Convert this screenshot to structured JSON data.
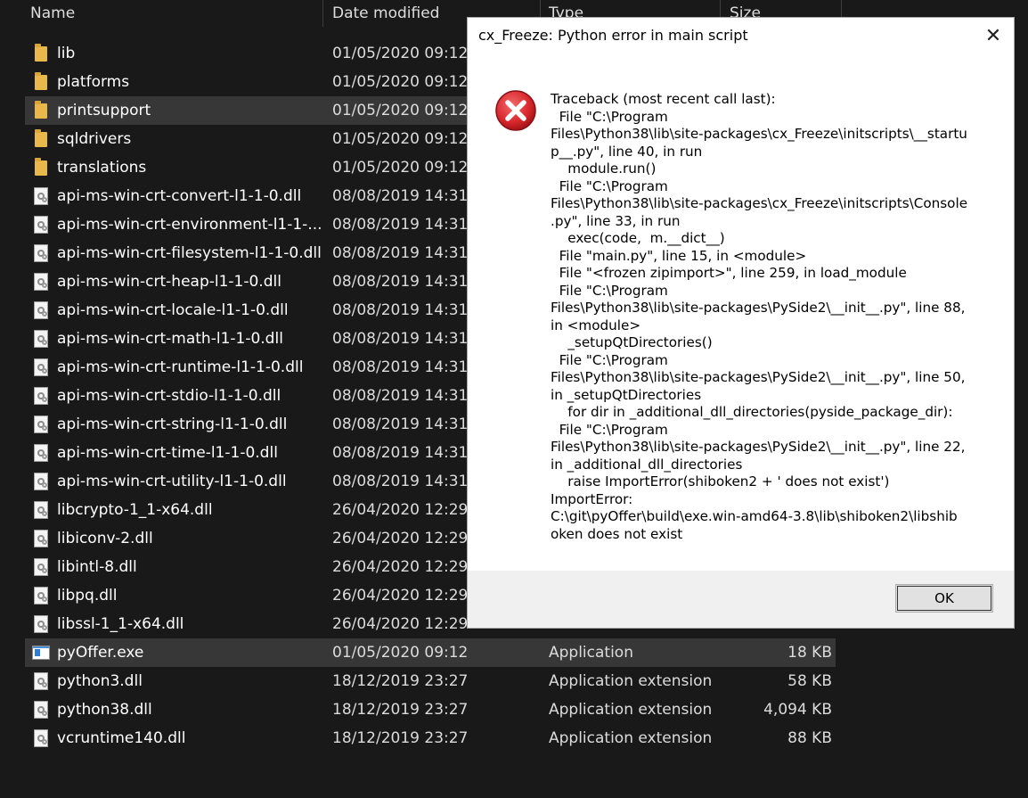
{
  "explorer": {
    "columns": {
      "name": "Name",
      "date": "Date modified",
      "type": "Type",
      "size": "Size"
    },
    "rows": [
      {
        "name": "lib",
        "date": "01/05/2020 09:12",
        "type": "",
        "size": "",
        "icon": "folder-icon"
      },
      {
        "name": "platforms",
        "date": "01/05/2020 09:12",
        "type": "",
        "size": "",
        "icon": "folder-icon"
      },
      {
        "name": "printsupport",
        "date": "01/05/2020 09:12",
        "type": "",
        "size": "",
        "icon": "folder-icon",
        "selected": true
      },
      {
        "name": "sqldrivers",
        "date": "01/05/2020 09:12",
        "type": "",
        "size": "",
        "icon": "folder-icon"
      },
      {
        "name": "translations",
        "date": "01/05/2020 09:12",
        "type": "",
        "size": "",
        "icon": "folder-icon"
      },
      {
        "name": "api-ms-win-crt-convert-l1-1-0.dll",
        "date": "08/08/2019 14:31",
        "type": "",
        "size": "",
        "icon": "dll-file-icon"
      },
      {
        "name": "api-ms-win-crt-environment-l1-1-...",
        "date": "08/08/2019 14:31",
        "type": "",
        "size": "",
        "icon": "dll-file-icon"
      },
      {
        "name": "api-ms-win-crt-filesystem-l1-1-0.dll",
        "date": "08/08/2019 14:31",
        "type": "",
        "size": "",
        "icon": "dll-file-icon"
      },
      {
        "name": "api-ms-win-crt-heap-l1-1-0.dll",
        "date": "08/08/2019 14:31",
        "type": "",
        "size": "",
        "icon": "dll-file-icon"
      },
      {
        "name": "api-ms-win-crt-locale-l1-1-0.dll",
        "date": "08/08/2019 14:31",
        "type": "",
        "size": "",
        "icon": "dll-file-icon"
      },
      {
        "name": "api-ms-win-crt-math-l1-1-0.dll",
        "date": "08/08/2019 14:31",
        "type": "",
        "size": "",
        "icon": "dll-file-icon"
      },
      {
        "name": "api-ms-win-crt-runtime-l1-1-0.dll",
        "date": "08/08/2019 14:31",
        "type": "",
        "size": "",
        "icon": "dll-file-icon"
      },
      {
        "name": "api-ms-win-crt-stdio-l1-1-0.dll",
        "date": "08/08/2019 14:31",
        "type": "",
        "size": "",
        "icon": "dll-file-icon"
      },
      {
        "name": "api-ms-win-crt-string-l1-1-0.dll",
        "date": "08/08/2019 14:31",
        "type": "",
        "size": "",
        "icon": "dll-file-icon"
      },
      {
        "name": "api-ms-win-crt-time-l1-1-0.dll",
        "date": "08/08/2019 14:31",
        "type": "",
        "size": "",
        "icon": "dll-file-icon"
      },
      {
        "name": "api-ms-win-crt-utility-l1-1-0.dll",
        "date": "08/08/2019 14:31",
        "type": "",
        "size": "",
        "icon": "dll-file-icon"
      },
      {
        "name": "libcrypto-1_1-x64.dll",
        "date": "26/04/2020 12:29",
        "type": "",
        "size": "",
        "icon": "dll-file-icon"
      },
      {
        "name": "libiconv-2.dll",
        "date": "26/04/2020 12:29",
        "type": "",
        "size": "",
        "icon": "dll-file-icon"
      },
      {
        "name": "libintl-8.dll",
        "date": "26/04/2020 12:29",
        "type": "",
        "size": "",
        "icon": "dll-file-icon"
      },
      {
        "name": "libpq.dll",
        "date": "26/04/2020 12:29",
        "type": "",
        "size": "",
        "icon": "dll-file-icon"
      },
      {
        "name": "libssl-1_1-x64.dll",
        "date": "26/04/2020 12:29",
        "type": "",
        "size": "",
        "icon": "dll-file-icon"
      },
      {
        "name": "pyOffer.exe",
        "date": "01/05/2020 09:12",
        "type": "Application",
        "size": "18 KB",
        "icon": "exe-file-icon",
        "selected": true
      },
      {
        "name": "python3.dll",
        "date": "18/12/2019 23:27",
        "type": "Application extension",
        "size": "58 KB",
        "icon": "dll-file-icon"
      },
      {
        "name": "python38.dll",
        "date": "18/12/2019 23:27",
        "type": "Application extension",
        "size": "4,094 KB",
        "icon": "dll-file-icon"
      },
      {
        "name": "vcruntime140.dll",
        "date": "18/12/2019 23:27",
        "type": "Application extension",
        "size": "88 KB",
        "icon": "dll-file-icon"
      }
    ]
  },
  "dialog": {
    "title": "cx_Freeze: Python error in main script",
    "close_label": "✕",
    "icon": "error-icon",
    "message": "Traceback (most recent call last):\n  File \"C:\\Program\nFiles\\Python38\\lib\\site-packages\\cx_Freeze\\initscripts\\__startu\np__.py\", line 40, in run\n    module.run()\n  File \"C:\\Program\nFiles\\Python38\\lib\\site-packages\\cx_Freeze\\initscripts\\Console\n.py\", line 33, in run\n    exec(code,  m.__dict__)\n  File \"main.py\", line 15, in <module>\n  File \"<frozen zipimport>\", line 259, in load_module\n  File \"C:\\Program\nFiles\\Python38\\lib\\site-packages\\PySide2\\__init__.py\", line 88,\nin <module>\n    _setupQtDirectories()\n  File \"C:\\Program\nFiles\\Python38\\lib\\site-packages\\PySide2\\__init__.py\", line 50,\nin _setupQtDirectories\n    for dir in _additional_dll_directories(pyside_package_dir):\n  File \"C:\\Program\nFiles\\Python38\\lib\\site-packages\\PySide2\\__init__.py\", line 22,\nin _additional_dll_directories\n    raise ImportError(shiboken2 + ' does not exist')\nImportError:\nC:\\git\\pyOffer\\build\\exe.win-amd64-3.8\\lib\\shiboken2\\libshib\noken does not exist",
    "ok_label": "OK"
  },
  "colors": {
    "background": "#191919",
    "selected_row": "#373737",
    "dialog_bg": "#ffffff",
    "dialog_footer": "#f0f0f0",
    "error_red": "#d8262c"
  }
}
